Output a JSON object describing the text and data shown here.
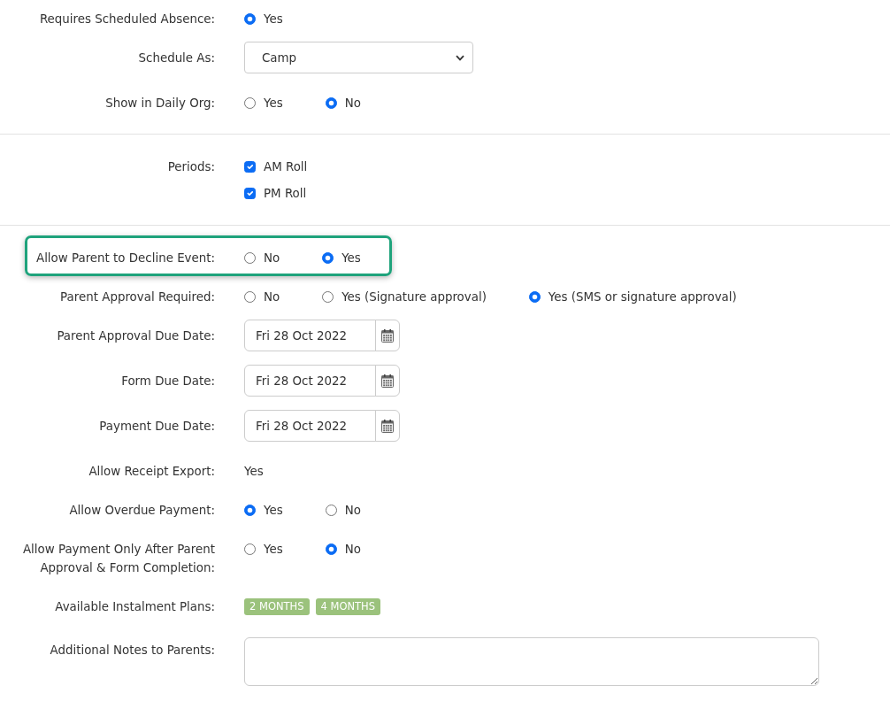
{
  "sections": [
    {
      "fields": [
        {
          "kind": "radio",
          "label": "Requires Scheduled Absence:",
          "highlighted": false,
          "options": [
            {
              "label": "Yes",
              "selected": true
            }
          ]
        },
        {
          "kind": "select",
          "label": "Schedule As:",
          "highlighted": false,
          "value": "Camp"
        },
        {
          "kind": "radio",
          "label": "Show in Daily Org:",
          "highlighted": false,
          "options": [
            {
              "label": "Yes",
              "selected": false
            },
            {
              "label": "No",
              "selected": true
            }
          ]
        }
      ]
    },
    {
      "fields": [
        {
          "kind": "checkboxes",
          "label": "Periods:",
          "highlighted": false,
          "options": [
            {
              "label": "AM Roll",
              "checked": true
            },
            {
              "label": "PM Roll",
              "checked": true
            }
          ]
        }
      ]
    },
    {
      "fields": [
        {
          "kind": "radio",
          "label": "Allow Parent to Decline Event:",
          "highlighted": true,
          "options": [
            {
              "label": "No",
              "selected": false
            },
            {
              "label": "Yes",
              "selected": true
            }
          ]
        },
        {
          "kind": "radio",
          "label": "Parent Approval Required:",
          "highlighted": false,
          "options": [
            {
              "label": "No",
              "selected": false
            },
            {
              "label": "Yes (Signature approval)",
              "selected": false
            },
            {
              "label": "Yes (SMS or signature approval)",
              "selected": true
            }
          ]
        },
        {
          "kind": "date",
          "label": "Parent Approval Due Date:",
          "highlighted": false,
          "value": "Fri 28 Oct 2022"
        },
        {
          "kind": "date",
          "label": "Form Due Date:",
          "highlighted": false,
          "value": "Fri 28 Oct 2022"
        },
        {
          "kind": "date",
          "label": "Payment Due Date:",
          "highlighted": false,
          "value": "Fri 28 Oct 2022"
        },
        {
          "kind": "static",
          "label": "Allow Receipt Export:",
          "highlighted": false,
          "value": "Yes"
        },
        {
          "kind": "radio",
          "label": "Allow Overdue Payment:",
          "highlighted": false,
          "options": [
            {
              "label": "Yes",
              "selected": true
            },
            {
              "label": "No",
              "selected": false
            }
          ]
        },
        {
          "kind": "radio",
          "label": "Allow Payment Only After Parent Approval & Form Completion:",
          "highlighted": false,
          "options": [
            {
              "label": "Yes",
              "selected": false
            },
            {
              "label": "No",
              "selected": true
            }
          ]
        },
        {
          "kind": "badges",
          "label": "Available Instalment Plans:",
          "highlighted": false,
          "badges": [
            "2 MONTHS",
            "4 MONTHS"
          ]
        },
        {
          "kind": "textarea",
          "label": "Additional Notes to Parents:",
          "highlighted": false
        }
      ]
    }
  ]
}
